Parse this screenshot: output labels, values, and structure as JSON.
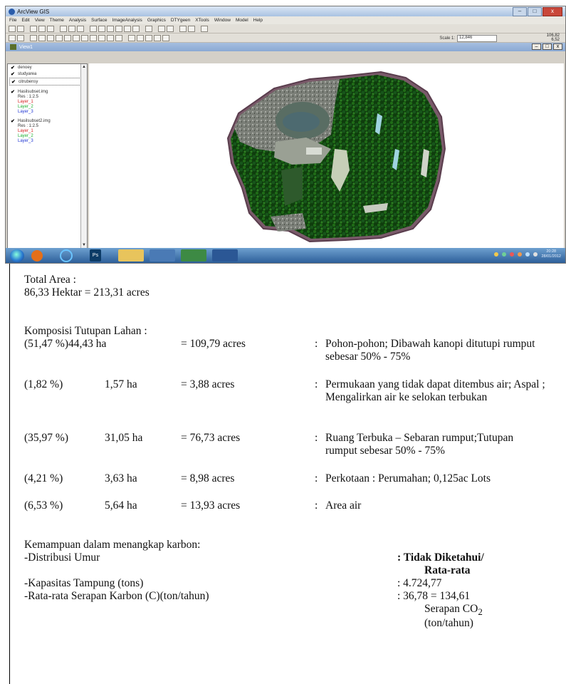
{
  "window": {
    "title": "ArcView GIS",
    "menus": [
      "File",
      "Edit",
      "View",
      "Theme",
      "Analysis",
      "Surface",
      "ImageAnalysis",
      "Graphics",
      "DTYgeen",
      "XTools",
      "Window",
      "Model",
      "Help"
    ],
    "scale_label": "Scale 1:",
    "scale_value": "12,846",
    "coords": [
      "106,82",
      "6,52"
    ],
    "view_title": "View1",
    "controls": {
      "minimize": "–",
      "maximize": "□",
      "close": "x"
    }
  },
  "toc": {
    "layers": [
      {
        "name": "denoey",
        "checked": true,
        "sub": []
      },
      {
        "name": "studyarea",
        "checked": true,
        "sub": []
      },
      {
        "name": "citrubensy",
        "checked": true,
        "sub": []
      },
      {
        "name": "Hasilsubset.img",
        "checked": true,
        "sub": [
          "Res : 1:2.5",
          "Layer_1",
          "Layer_2",
          "Layer_3"
        ]
      },
      {
        "name": "Hasilsubset2.img",
        "checked": true,
        "sub": [
          "Res : 1:2.5",
          "Layer_1",
          "Layer_2",
          "Layer_3"
        ]
      }
    ]
  },
  "taskbar": {
    "clock_time": "20:28",
    "clock_date": "28/01/2012",
    "apps": [
      "media",
      "ie",
      "Ps",
      "folder",
      "doc",
      "xls",
      "search"
    ]
  },
  "doc": {
    "total_area_label": "Total Area :",
    "total_area_value": "86,33 Hektar = 213,31 acres",
    "komposisi_label": "Komposisi Tutupan Lahan :",
    "rows": [
      {
        "pct": "(51,47 %)44,43 ha",
        "ha": "",
        "acres": "= 109,79 acres",
        "desc": "Pohon-pohon; Dibawah kanopi ditutupi rumput  sebesar 50% - 75%"
      },
      {
        "pct": "(1,82 %)",
        "ha": "1,57 ha",
        "acres": "= 3,88 acres",
        "desc": "Permukaan yang tidak dapat ditembus air; Aspal ; Mengalirkan air ke selokan terbukan"
      },
      {
        "pct": "(35,97 %)",
        "ha": "31,05 ha",
        "acres": "= 76,73 acres",
        "desc": "Ruang Terbuka – Sebaran rumput;Tutupan rumput sebesar 50% - 75%"
      },
      {
        "pct": "(4,21 %)",
        "ha": "3,63 ha",
        "acres": "= 8,98 acres",
        "desc": "Perkotaan : Perumahan; 0,125ac Lots"
      },
      {
        "pct": "(6,53 %)",
        "ha": "5,64 ha",
        "acres": "= 13,93 acres",
        "desc": "Area air"
      }
    ],
    "colon": ":",
    "kemampuan_label": "Kemampuan dalam menangkap karbon:",
    "distribusi_label": "-Distribusi Umur",
    "distribusi_value_1": ": Tidak Diketahui/",
    "distribusi_value_2": "Rata-rata",
    "kapasitas_label": "-Kapasitas Tampung (tons)",
    "kapasitas_value": ": 4.724,77",
    "serapan_label": "-Rata-rata Serapan Karbon (C)(ton/tahun)",
    "serapan_value": ": 36,78 = 134,61",
    "serapan_co2_prefix": "Serapan CO",
    "serapan_co2_sub": "2",
    "serapan_unit": "(ton/tahun)"
  }
}
